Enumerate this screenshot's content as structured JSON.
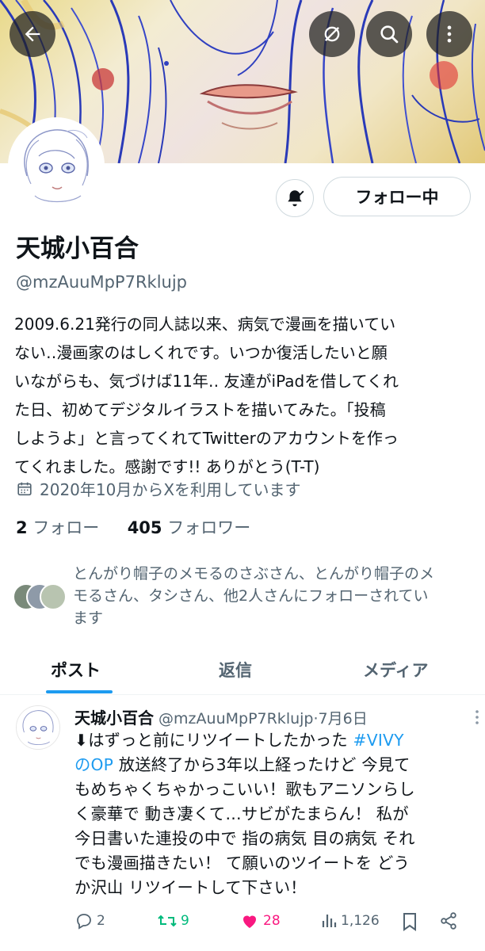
{
  "profile": {
    "name": "天城小百合",
    "handle": "@mzAuuMpP7Rklujp",
    "bio_lines": [
      "2009.6.21発行の同人誌以来、病気で漫画を描いてい",
      "ない‥漫画家のはしくれです。いつか復活したいと願",
      "いながらも、気づけば11年‥ 友達がiPadを借してくれ",
      "た日、初めてデジタルイラストを描いてみた。「投稿",
      "しようよ」と言ってくれてTwitterのアカウントを作っ",
      "てくれました。感謝です!! ありがとう(T-T)"
    ],
    "joined": "2020年10月からXを利用しています",
    "following_count": "2",
    "following_label": "フォロー",
    "followers_count": "405",
    "followers_label": "フォロワー",
    "followed_by_lines": [
      "とんがり帽子のメモるのさぶさん、とんがり帽子のメ",
      "モるさん、タシさん、他2人さんにフォローされてい",
      "ます"
    ],
    "follow_button": "フォロー中"
  },
  "tabs": [
    {
      "label": "ポスト",
      "active": true
    },
    {
      "label": "返信",
      "active": false
    },
    {
      "label": "メディア",
      "active": false
    }
  ],
  "post": {
    "author": "天城小百合",
    "handle": "@mzAuuMpP7Rklujp",
    "separator": "·",
    "date": "7月6日",
    "lines": [
      {
        "pre": "⬇はずっと前にリツイートしたかった ",
        "tag": "#VIVY"
      },
      {
        "tag": "のOP",
        "post": " 放送終了から3年以上経ったけど 今見て"
      },
      {
        "pre": "もめちゃくちゃかっこいい！歌もアニソンらし"
      },
      {
        "pre": "く豪華で 動き凄くて…サビがたまらん！ 私が"
      },
      {
        "pre": "今日書いた連投の中で 指の病気 目の病気 それ"
      },
      {
        "pre": "でも漫画描きたい！ て願いのツイートを どう"
      },
      {
        "pre": "か沢山 リツイートして下さい！"
      }
    ],
    "replies": "2",
    "reposts": "9",
    "likes": "28",
    "views": "1,126"
  },
  "colors": {
    "accent": "#1d9bf0",
    "repost": "#00ba7c",
    "like": "#f91880",
    "secondary_text": "#536471"
  },
  "icons": [
    "back-arrow-icon",
    "link-off-icon",
    "search-icon",
    "more-vertical-icon",
    "bell-check-icon",
    "calendar-icon",
    "reply-icon",
    "repost-icon",
    "heart-icon",
    "views-icon",
    "bookmark-icon",
    "share-icon"
  ]
}
